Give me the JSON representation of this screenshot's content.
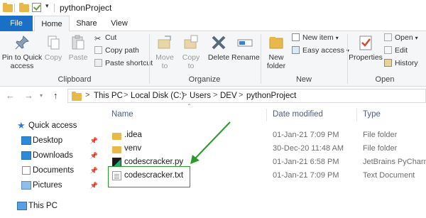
{
  "titlebar": {
    "title": "pythonProject",
    "quick_access_arrow": "▾"
  },
  "tabs": {
    "file": "File",
    "home": "Home",
    "share": "Share",
    "view": "View"
  },
  "ribbon": {
    "clipboard": {
      "label": "Clipboard",
      "pin": "Pin to Quick access",
      "copy": "Copy",
      "paste": "Paste",
      "cut": "Cut",
      "copy_path": "Copy path",
      "paste_shortcut": "Paste shortcut"
    },
    "organize": {
      "label": "Organize",
      "move_to": "Move to",
      "copy_to": "Copy to",
      "delete": "Delete",
      "rename": "Rename"
    },
    "new": {
      "label": "New",
      "new_folder": "New folder",
      "new_item": "New item",
      "easy_access": "Easy access"
    },
    "open": {
      "label": "Open",
      "properties": "Properties",
      "open": "Open",
      "edit": "Edit",
      "history": "History"
    }
  },
  "address": {
    "crumbs": [
      "This PC",
      "Local Disk (C:)",
      "Users",
      "DEV",
      "pythonProject"
    ],
    "separator": ">"
  },
  "nav_pane": {
    "quick_access": "Quick access",
    "items": [
      "Desktop",
      "Downloads",
      "Documents",
      "Pictures"
    ],
    "this_pc": "This PC"
  },
  "columns": {
    "name": "Name",
    "date": "Date modified",
    "type": "Type"
  },
  "files": [
    {
      "name": ".idea",
      "date": "01-Jan-21 7:09 PM",
      "type": "File folder",
      "icon": "folder-icon"
    },
    {
      "name": "venv",
      "date": "30-Dec-20 11:48 AM",
      "type": "File folder",
      "icon": "folder-icon"
    },
    {
      "name": "codescracker.py",
      "date": "01-Jan-21 6:58 PM",
      "type": "JetBrains PyCharm",
      "icon": "python-file-icon"
    },
    {
      "name": "codescracker.txt",
      "date": "01-Jan-21 7:09 PM",
      "type": "Text Document",
      "icon": "text-file-icon"
    }
  ],
  "colors": {
    "file_tab": "#1a6fc7",
    "annotation": "#2a9a2a",
    "folder": "#e8b94a"
  }
}
